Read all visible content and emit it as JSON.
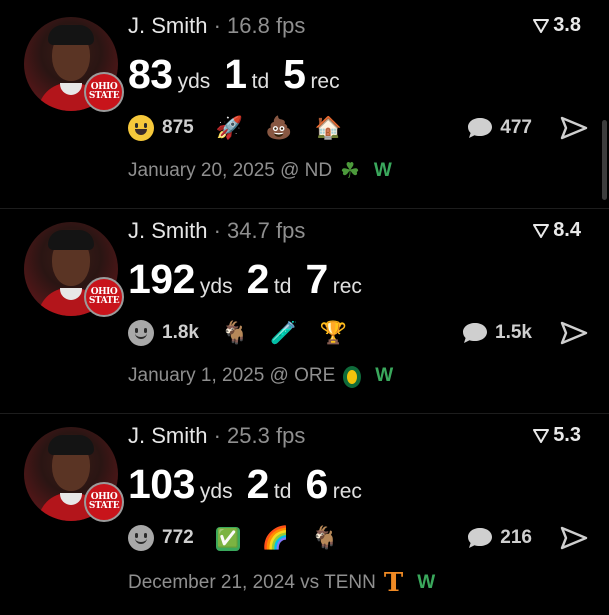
{
  "posts": [
    {
      "player": "J. Smith",
      "fps": "16.8 fps",
      "rating": "3.8",
      "yds": "83",
      "yds_unit": "yds",
      "td": "1",
      "td_unit": "td",
      "rec": "5",
      "rec_unit": "rec",
      "reaction_count": "875",
      "reaction_face": "smile",
      "emojis": [
        "🚀",
        "💩",
        "🏠"
      ],
      "comment_count": "477",
      "date_text": "January 20, 2025 @ ND",
      "team_icon": "☘",
      "team_icon_color": "#4c9a3b",
      "result": "W",
      "logo_text": "OHIO STATE"
    },
    {
      "player": "J. Smith",
      "fps": "34.7 fps",
      "rating": "8.4",
      "yds": "192",
      "yds_unit": "yds",
      "td": "2",
      "td_unit": "td",
      "rec": "7",
      "rec_unit": "rec",
      "reaction_count": "1.8k",
      "reaction_face": "neutral",
      "emojis": [
        "🐐",
        "🧪",
        "🏆"
      ],
      "comment_count": "1.5k",
      "date_text": "January 1, 2025 @ ORE",
      "team_icon": "O",
      "team_icon_color": "#0f6b3a",
      "result": "W",
      "logo_text": "OHIO STATE"
    },
    {
      "player": "J. Smith",
      "fps": "25.3 fps",
      "rating": "5.3",
      "yds": "103",
      "yds_unit": "yds",
      "td": "2",
      "td_unit": "td",
      "rec": "6",
      "rec_unit": "rec",
      "reaction_count": "772",
      "reaction_face": "neutral",
      "emojis": [
        "✅",
        "🌈",
        "🐐"
      ],
      "comment_count": "216",
      "date_text": "December 21, 2024 vs TENN",
      "team_icon": "T",
      "team_icon_color": "#f08a24",
      "result": "W",
      "logo_text": "OHIO STATE"
    }
  ]
}
